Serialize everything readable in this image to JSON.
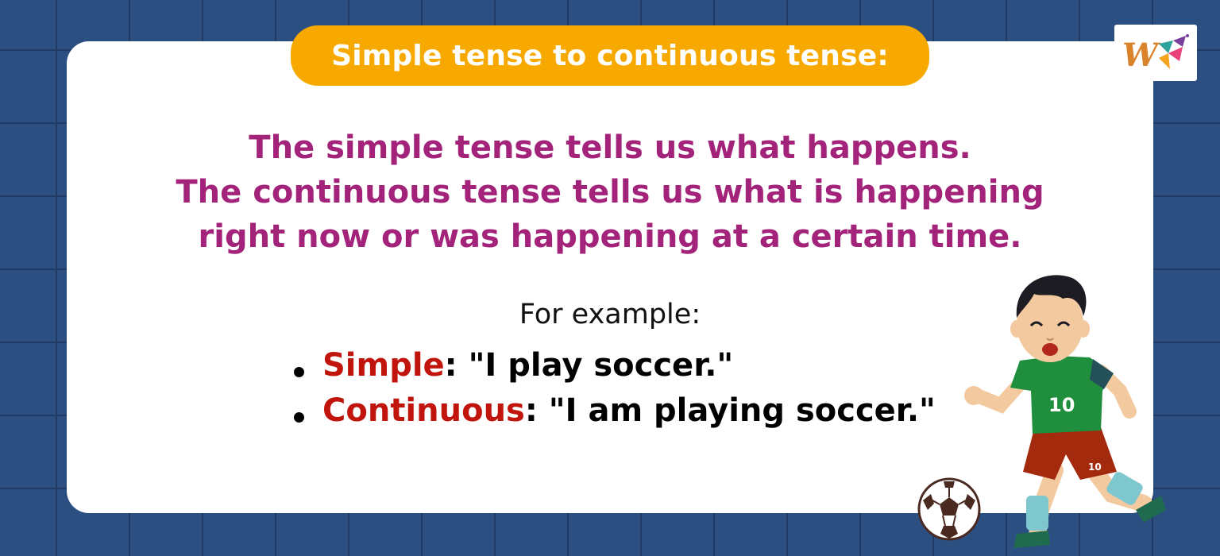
{
  "header": {
    "title": "Simple tense to continuous tense:"
  },
  "definition": {
    "lines": [
      "The simple tense tells us what happens.",
      "The continuous tense tells us what is happening",
      "right now or was happening at a certain time."
    ]
  },
  "examples": {
    "intro": "For example:",
    "items": [
      {
        "term": "Simple",
        "sentence": ": \"I play soccer.\""
      },
      {
        "term": "Continuous",
        "sentence": ": \"I am playing soccer.\""
      }
    ]
  },
  "illustration": {
    "jersey_number": "10",
    "shorts_number": "10"
  },
  "colors": {
    "background": "#2c4f82",
    "title_pill": "#f7a900",
    "definition_text": "#a3237a",
    "keyword": "#c0140c"
  },
  "icons": [
    "brand-logo-icon",
    "soccer-ball-icon",
    "soccer-player-illustration"
  ]
}
